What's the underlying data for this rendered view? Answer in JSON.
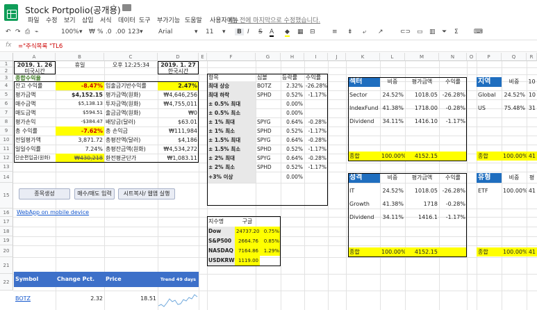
{
  "app": {
    "title": "Stock Portpolio(공개용)",
    "last_edit": "7분 전에 마지막으로 수정했습니다."
  },
  "menu": [
    "파일",
    "수정",
    "보기",
    "삽입",
    "서식",
    "데이터",
    "도구",
    "부가기능",
    "도움말",
    "사용자메뉴"
  ],
  "toolbar": {
    "zoom": "100%",
    "currency": "₩",
    "percent": "%",
    "dec0": ".0",
    "dec00": ".00",
    "numfmt": "123▾",
    "font": "Arial",
    "size": "11"
  },
  "formula": {
    "fx": "fx",
    "value": "=\"주식목록 \"TL6"
  },
  "columns": [
    "A",
    "B",
    "C",
    "D",
    "E",
    "F",
    "G",
    "H",
    "I",
    "J",
    "K",
    "L",
    "M",
    "N",
    "O",
    "P",
    "Q",
    "R"
  ],
  "rows": [
    "1",
    "2",
    "3",
    "4",
    "5",
    "6",
    "7",
    "8",
    "9",
    "10",
    "11",
    "12",
    "13",
    "14",
    "15",
    "16",
    "17",
    "18",
    "19",
    "20",
    "21",
    "22"
  ],
  "left": {
    "date_us": "2019. 1. 26",
    "tz_us": "미국시간",
    "holiday": "휴일",
    "time": "오후 12:25:34",
    "date_kr": "2019. 1. 27",
    "tz_kr": "한국시간",
    "section": "종합수익율",
    "labels_a": [
      "잔고 수익률",
      "평가금액",
      "매수금액",
      "매도금액",
      "평가손익",
      "총 수익률",
      "전일평가액",
      "일일수익률",
      "단순편입금(원화)"
    ],
    "values_b": [
      "-8.47%",
      "$4,152.15",
      "$5,138.13",
      "$594.51",
      "-$384.47",
      "-7.62%",
      "3,871.72",
      "7.24%",
      "₩430,218"
    ],
    "labels_c": [
      "입출금기반수익률",
      "평가금액(원화)",
      "투자금액(원화)",
      "출금금액(원화)",
      "배당금(달러)",
      "총 손익금",
      "총평잔액(달러)",
      "총평잔금액(원화)",
      "환전평균단가"
    ],
    "values_d": [
      "2.47%",
      "₩4,646,256",
      "₩4,755,011",
      "₩0",
      "$63.01",
      "₩111,984",
      "$4,186",
      "₩4,534,272",
      "₩1,083.11"
    ],
    "buttons": [
      "종목생성",
      "매수/매도 입력",
      "시트복사/ 웹앱 실행"
    ],
    "webapp_link": "WebApp on mobile device"
  },
  "stats": {
    "headers": [
      "항목",
      "심볼",
      "등락률",
      "수익률"
    ],
    "rows": [
      [
        "최대 상승",
        "BOTZ",
        "2.32%",
        "-26.28%"
      ],
      [
        "최대 하락",
        "SPHD",
        "0.52%",
        "-1.17%"
      ],
      [
        "± 0.5% 최대",
        "",
        "0.00%",
        ""
      ],
      [
        "± 0.5% 최소",
        "",
        "0.00%",
        ""
      ],
      [
        "± 1% 최대",
        "SPYG",
        "0.64%",
        "-0.28%"
      ],
      [
        "± 1% 최소",
        "SPHD",
        "0.52%",
        "-1.17%"
      ],
      [
        "± 1.5% 최대",
        "SPYG",
        "0.64%",
        "-0.28%"
      ],
      [
        "± 1.5% 최소",
        "SPHD",
        "0.52%",
        "-1.17%"
      ],
      [
        "± 2% 최대",
        "SPYG",
        "0.64%",
        "-0.28%"
      ],
      [
        "± 2% 최소",
        "SPHD",
        "0.52%",
        "-1.17%"
      ],
      [
        "+3% 이상",
        "",
        "0.00%",
        ""
      ]
    ]
  },
  "index": {
    "headers": [
      "지수명",
      "구글"
    ],
    "rows": [
      [
        "Dow",
        "24737.20",
        "0.75%"
      ],
      [
        "S&P500",
        "2664.76",
        "0.85%"
      ],
      [
        "NASDAQ",
        "7164.86",
        "1.29%"
      ],
      [
        "USDKRW",
        "1119.00",
        ""
      ]
    ]
  },
  "sector": {
    "headers": [
      "섹터",
      "비중",
      "평가금액",
      "수익률"
    ],
    "rows": [
      [
        "Sector",
        "24.52%",
        "1018.05",
        "-26.28%"
      ],
      [
        "IndexFund",
        "41.38%",
        "1718.00",
        "-0.28%"
      ],
      [
        "Dividend",
        "34.11%",
        "1416.10",
        "-1.17%"
      ]
    ],
    "total": [
      "종합",
      "100.00%",
      "4152.15"
    ]
  },
  "style": {
    "headers": [
      "성격",
      "비중",
      "평가금액",
      "수익률"
    ],
    "rows": [
      [
        "IT",
        "24.52%",
        "1018.05",
        "-26.28%"
      ],
      [
        "Growth",
        "41.38%",
        "1718",
        "-0.28%"
      ],
      [
        "Dividend",
        "34.11%",
        "1416.1",
        "-1.17%"
      ]
    ],
    "total": [
      "종합",
      "100.00%",
      "4152.15"
    ]
  },
  "region": {
    "headers": [
      "지역",
      "비중",
      "10"
    ],
    "rows": [
      [
        "Global",
        "24.52%",
        "10"
      ],
      [
        "US",
        "75.48%",
        "31"
      ]
    ],
    "total": [
      "종합",
      "100.00%",
      "41"
    ]
  },
  "type": {
    "headers": [
      "유형",
      "비중",
      "평"
    ],
    "rows": [
      [
        "ETF",
        "100.00%",
        "41"
      ]
    ],
    "total": [
      "종합",
      "100.00%",
      "41"
    ]
  },
  "stock_table": {
    "headers": [
      "Symbol",
      "Change Pct.",
      "Price",
      "Trend 49 days"
    ],
    "rows": [
      [
        "BOTZ",
        "2.32",
        "18.51"
      ]
    ]
  },
  "colors": {
    "accent": "#1155cc",
    "highlight": "#ffff00",
    "total_fill": "#ffff00",
    "header_fill": "#cfe2f3"
  }
}
